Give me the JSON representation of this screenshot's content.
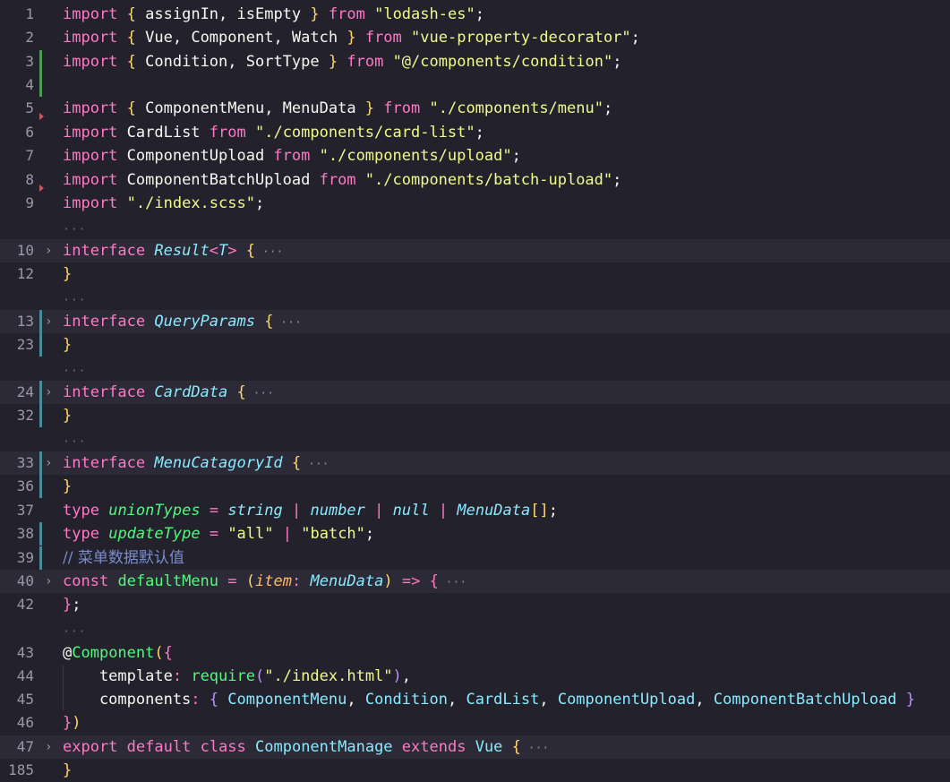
{
  "lines": [
    {
      "num": "1",
      "tokens": [
        {
          "t": "import",
          "c": "kw"
        },
        {
          "t": " "
        },
        {
          "t": "{",
          "c": "br"
        },
        {
          "t": " assignIn, isEmpty "
        },
        {
          "t": "}",
          "c": "br"
        },
        {
          "t": " "
        },
        {
          "t": "from",
          "c": "kw"
        },
        {
          "t": " "
        },
        {
          "t": "\"lodash-es\"",
          "c": "str"
        },
        {
          "t": ";"
        }
      ]
    },
    {
      "num": "2",
      "tokens": [
        {
          "t": "import",
          "c": "kw"
        },
        {
          "t": " "
        },
        {
          "t": "{",
          "c": "br"
        },
        {
          "t": " Vue, Component, Watch "
        },
        {
          "t": "}",
          "c": "br"
        },
        {
          "t": " "
        },
        {
          "t": "from",
          "c": "kw"
        },
        {
          "t": " "
        },
        {
          "t": "\"vue-property-decorator\"",
          "c": "str"
        },
        {
          "t": ";"
        }
      ]
    },
    {
      "num": "3",
      "tokens": [
        {
          "t": "import",
          "c": "kw"
        },
        {
          "t": " "
        },
        {
          "t": "{",
          "c": "br"
        },
        {
          "t": " Condition, SortType "
        },
        {
          "t": "}",
          "c": "br"
        },
        {
          "t": " "
        },
        {
          "t": "from",
          "c": "kw"
        },
        {
          "t": " "
        },
        {
          "t": "\"@/components/condition\"",
          "c": "str"
        },
        {
          "t": ";"
        }
      ]
    },
    {
      "num": "4",
      "tokens": []
    },
    {
      "num": "5",
      "tokens": [
        {
          "t": "import",
          "c": "kw"
        },
        {
          "t": " "
        },
        {
          "t": "{",
          "c": "br"
        },
        {
          "t": " ComponentMenu, MenuData "
        },
        {
          "t": "}",
          "c": "br"
        },
        {
          "t": " "
        },
        {
          "t": "from",
          "c": "kw"
        },
        {
          "t": " "
        },
        {
          "t": "\"./components/menu\"",
          "c": "str"
        },
        {
          "t": ";"
        }
      ]
    },
    {
      "num": "6",
      "tokens": [
        {
          "t": "import",
          "c": "kw"
        },
        {
          "t": " CardList "
        },
        {
          "t": "from",
          "c": "kw"
        },
        {
          "t": " "
        },
        {
          "t": "\"./components/card-list\"",
          "c": "str"
        },
        {
          "t": ";"
        }
      ]
    },
    {
      "num": "7",
      "tokens": [
        {
          "t": "import",
          "c": "kw"
        },
        {
          "t": " ComponentUpload "
        },
        {
          "t": "from",
          "c": "kw"
        },
        {
          "t": " "
        },
        {
          "t": "\"./components/upload\"",
          "c": "str"
        },
        {
          "t": ";"
        }
      ]
    },
    {
      "num": "8",
      "tokens": [
        {
          "t": "import",
          "c": "kw"
        },
        {
          "t": " ComponentBatchUpload "
        },
        {
          "t": "from",
          "c": "kw"
        },
        {
          "t": " "
        },
        {
          "t": "\"./components/batch-upload\"",
          "c": "str"
        },
        {
          "t": ";"
        }
      ]
    },
    {
      "num": "9",
      "tokens": [
        {
          "t": "import",
          "c": "kw"
        },
        {
          "t": " "
        },
        {
          "t": "\"./index.scss\"",
          "c": "str"
        },
        {
          "t": ";"
        }
      ]
    },
    {
      "num": "10",
      "tokens": [
        {
          "t": "interface",
          "c": "kw"
        },
        {
          "t": " "
        },
        {
          "t": "Result",
          "c": "type it"
        },
        {
          "t": "<",
          "c": "kw"
        },
        {
          "t": "T",
          "c": "type it"
        },
        {
          "t": ">",
          "c": "kw"
        },
        {
          "t": " "
        },
        {
          "t": "{",
          "c": "br"
        },
        {
          "t": " ···",
          "c": "fold-dots"
        }
      ]
    },
    {
      "num": "12",
      "tokens": [
        {
          "t": "}",
          "c": "br"
        }
      ]
    },
    {
      "num": "13",
      "tokens": [
        {
          "t": "interface",
          "c": "kw"
        },
        {
          "t": " "
        },
        {
          "t": "QueryParams",
          "c": "type it"
        },
        {
          "t": " "
        },
        {
          "t": "{",
          "c": "br"
        },
        {
          "t": " ···",
          "c": "fold-dots"
        }
      ]
    },
    {
      "num": "23",
      "tokens": [
        {
          "t": "}",
          "c": "br"
        }
      ]
    },
    {
      "num": "24",
      "tokens": [
        {
          "t": "interface",
          "c": "kw"
        },
        {
          "t": " "
        },
        {
          "t": "CardData",
          "c": "type it"
        },
        {
          "t": " "
        },
        {
          "t": "{",
          "c": "br"
        },
        {
          "t": " ···",
          "c": "fold-dots"
        }
      ]
    },
    {
      "num": "32",
      "tokens": [
        {
          "t": "}",
          "c": "br"
        }
      ]
    },
    {
      "num": "33",
      "tokens": [
        {
          "t": "interface",
          "c": "kw"
        },
        {
          "t": " "
        },
        {
          "t": "MenuCatagoryId",
          "c": "type it"
        },
        {
          "t": " "
        },
        {
          "t": "{",
          "c": "br"
        },
        {
          "t": " ···",
          "c": "fold-dots"
        }
      ]
    },
    {
      "num": "36",
      "tokens": [
        {
          "t": "}",
          "c": "br"
        }
      ]
    },
    {
      "num": "37",
      "tokens": [
        {
          "t": "type",
          "c": "kw"
        },
        {
          "t": " "
        },
        {
          "t": "unionTypes",
          "c": "fn it"
        },
        {
          "t": " "
        },
        {
          "t": "=",
          "c": "kw"
        },
        {
          "t": " "
        },
        {
          "t": "string",
          "c": "type it"
        },
        {
          "t": " "
        },
        {
          "t": "|",
          "c": "kw"
        },
        {
          "t": " "
        },
        {
          "t": "number",
          "c": "type it"
        },
        {
          "t": " "
        },
        {
          "t": "|",
          "c": "kw"
        },
        {
          "t": " "
        },
        {
          "t": "null",
          "c": "type it"
        },
        {
          "t": " "
        },
        {
          "t": "|",
          "c": "kw"
        },
        {
          "t": " "
        },
        {
          "t": "MenuData",
          "c": "type it"
        },
        {
          "t": "[]",
          "c": "br"
        },
        {
          "t": ";"
        }
      ]
    },
    {
      "num": "38",
      "tokens": [
        {
          "t": "type",
          "c": "kw"
        },
        {
          "t": " "
        },
        {
          "t": "updateType",
          "c": "fn it"
        },
        {
          "t": " "
        },
        {
          "t": "=",
          "c": "kw"
        },
        {
          "t": " "
        },
        {
          "t": "\"all\"",
          "c": "str"
        },
        {
          "t": " "
        },
        {
          "t": "|",
          "c": "kw"
        },
        {
          "t": " "
        },
        {
          "t": "\"batch\"",
          "c": "str"
        },
        {
          "t": ";"
        }
      ]
    },
    {
      "num": "39",
      "tokens": [
        {
          "t": "// 菜单数据默认值",
          "c": "cm"
        }
      ]
    },
    {
      "num": "40",
      "tokens": [
        {
          "t": "const",
          "c": "kw"
        },
        {
          "t": " "
        },
        {
          "t": "defaultMenu",
          "c": "fn"
        },
        {
          "t": " "
        },
        {
          "t": "=",
          "c": "kw"
        },
        {
          "t": " "
        },
        {
          "t": "(",
          "c": "br"
        },
        {
          "t": "item",
          "c": "param"
        },
        {
          "t": ":",
          "c": "kw"
        },
        {
          "t": " "
        },
        {
          "t": "MenuData",
          "c": "type it"
        },
        {
          "t": ")",
          "c": "br"
        },
        {
          "t": " "
        },
        {
          "t": "=>",
          "c": "kw"
        },
        {
          "t": " "
        },
        {
          "t": "{",
          "c": "br2"
        },
        {
          "t": " ···",
          "c": "fold-dots"
        }
      ]
    },
    {
      "num": "42",
      "tokens": [
        {
          "t": "}",
          "c": "br2"
        },
        {
          "t": ";"
        }
      ]
    },
    {
      "num": "43",
      "tokens": [
        {
          "t": "@",
          "c": "plain"
        },
        {
          "t": "Component",
          "c": "fn"
        },
        {
          "t": "(",
          "c": "br"
        },
        {
          "t": "{",
          "c": "br2"
        }
      ]
    },
    {
      "num": "44",
      "tokens": [
        {
          "t": "    template",
          "c": "plain"
        },
        {
          "t": ":",
          "c": "kw"
        },
        {
          "t": " "
        },
        {
          "t": "require",
          "c": "fn"
        },
        {
          "t": "(",
          "c": "kwb"
        },
        {
          "t": "\"./index.html\"",
          "c": "str"
        },
        {
          "t": ")",
          "c": "kwb"
        },
        {
          "t": ","
        }
      ]
    },
    {
      "num": "45",
      "tokens": [
        {
          "t": "    components",
          "c": "plain"
        },
        {
          "t": ":",
          "c": "kw"
        },
        {
          "t": " "
        },
        {
          "t": "{",
          "c": "kwb"
        },
        {
          "t": " "
        },
        {
          "t": "ComponentMenu",
          "c": "type"
        },
        {
          "t": ", "
        },
        {
          "t": "Condition",
          "c": "type"
        },
        {
          "t": ", "
        },
        {
          "t": "CardList",
          "c": "type"
        },
        {
          "t": ", "
        },
        {
          "t": "ComponentUpload",
          "c": "type"
        },
        {
          "t": ", "
        },
        {
          "t": "ComponentBatchUpload",
          "c": "type"
        },
        {
          "t": " "
        },
        {
          "t": "}",
          "c": "kwb"
        }
      ]
    },
    {
      "num": "46",
      "tokens": [
        {
          "t": "}",
          "c": "br2"
        },
        {
          "t": ")",
          "c": "br"
        }
      ]
    },
    {
      "num": "47",
      "tokens": [
        {
          "t": "export",
          "c": "kw"
        },
        {
          "t": " "
        },
        {
          "t": "default",
          "c": "kw"
        },
        {
          "t": " "
        },
        {
          "t": "class",
          "c": "kw"
        },
        {
          "t": " "
        },
        {
          "t": "ComponentManage",
          "c": "type"
        },
        {
          "t": " "
        },
        {
          "t": "extends",
          "c": "kw"
        },
        {
          "t": " "
        },
        {
          "t": "Vue",
          "c": "type"
        },
        {
          "t": " "
        },
        {
          "t": "{",
          "c": "br"
        },
        {
          "t": " ···",
          "c": "fold-dots"
        }
      ]
    },
    {
      "num": "185",
      "tokens": [
        {
          "t": "}",
          "c": "br"
        }
      ]
    }
  ],
  "fold_ellipsis": "···",
  "colors": {
    "background": "#22212c",
    "keyword": "#ff79c6",
    "string": "#f1fa8c",
    "type": "#8be9fd",
    "function": "#50fa7b",
    "comment": "#7a8cc8"
  }
}
